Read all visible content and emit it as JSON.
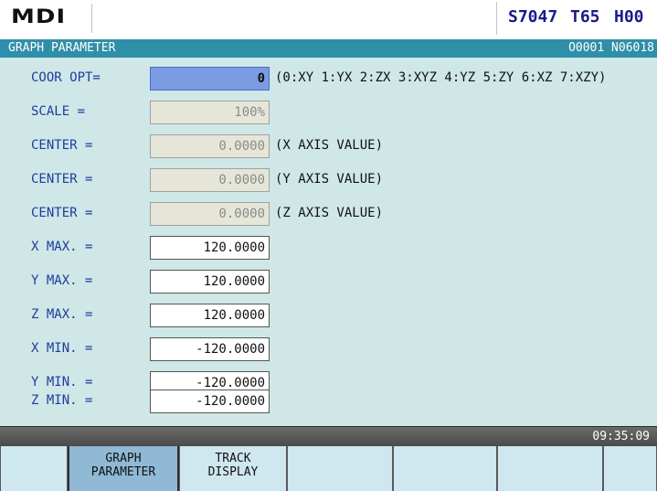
{
  "header": {
    "mode": "MDI",
    "spindle": "S7047",
    "tool": "T65",
    "h_code": "H00"
  },
  "title_bar": {
    "title": "GRAPH PARAMETER",
    "program": "O0001 N06018"
  },
  "params": [
    {
      "label": "COOR OPT=",
      "value": "0",
      "note": "(0:XY 1:YX 2:ZX 3:XYZ 4:YZ 5:ZY 6:XZ 7:XZY)",
      "state": "selected"
    },
    {
      "label": "SCALE   =",
      "value": "100%",
      "note": "",
      "state": "disabled"
    },
    {
      "label": "CENTER  =",
      "value": "0.0000",
      "note": "(X AXIS VALUE)",
      "state": "disabled"
    },
    {
      "label": "CENTER  =",
      "value": "0.0000",
      "note": "(Y AXIS VALUE)",
      "state": "disabled"
    },
    {
      "label": "CENTER  =",
      "value": "0.0000",
      "note": "(Z AXIS VALUE)",
      "state": "disabled"
    },
    {
      "label": "X MAX.  =",
      "value": "120.0000",
      "note": "",
      "state": "editable"
    },
    {
      "label": "Y MAX.  =",
      "value": "120.0000",
      "note": "",
      "state": "editable"
    },
    {
      "label": "Z MAX.  =",
      "value": "120.0000",
      "note": "",
      "state": "editable"
    },
    {
      "label": "X MIN.  =",
      "value": "-120.0000",
      "note": "",
      "state": "editable"
    },
    {
      "label": "Y MIN.  =",
      "value": "-120.0000",
      "note": "",
      "state": "editable"
    },
    {
      "label": "Z MIN.  =",
      "value": "-120.0000",
      "note": "",
      "state": "editable"
    }
  ],
  "status_bar": {
    "time": "09:35:09"
  },
  "softkeys": [
    {
      "line1": "",
      "line2": ""
    },
    {
      "line1": "GRAPH",
      "line2": "PARAMETER",
      "active": true
    },
    {
      "line1": "TRACK",
      "line2": "DISPLAY"
    },
    {
      "line1": "",
      "line2": ""
    },
    {
      "line1": "",
      "line2": ""
    },
    {
      "line1": "",
      "line2": ""
    },
    {
      "line1": "",
      "line2": ""
    }
  ],
  "colors": {
    "title_bar": "#2f8fa8",
    "panel": "#cfe7e7",
    "label_text": "#1e3c9c",
    "selected_field": "#7b9be3",
    "status_text": "#1a1a8a"
  }
}
